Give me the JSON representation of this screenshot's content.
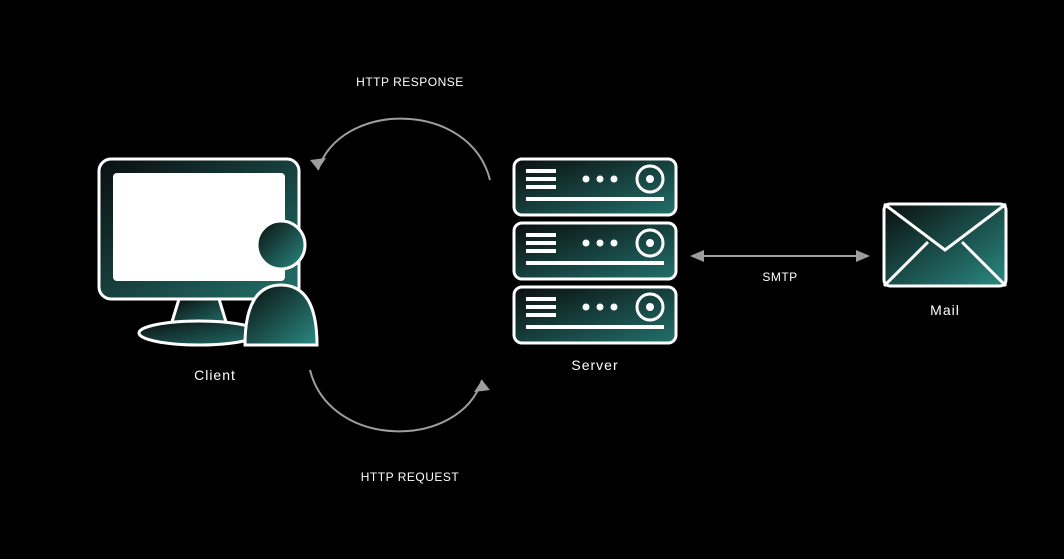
{
  "nodes": {
    "client": {
      "label": "Client"
    },
    "server": {
      "label": "Server"
    },
    "mail": {
      "label": "Mail"
    }
  },
  "connections": {
    "response": {
      "label": "HTTP RESPONSE"
    },
    "request": {
      "label": "HTTP REQUEST"
    },
    "smtp": {
      "label": "SMTP"
    }
  },
  "colors": {
    "grad_start": "#0a0e0e",
    "grad_end": "#22706b",
    "line": "#ffffff",
    "arrow": "#9e9e9e"
  }
}
